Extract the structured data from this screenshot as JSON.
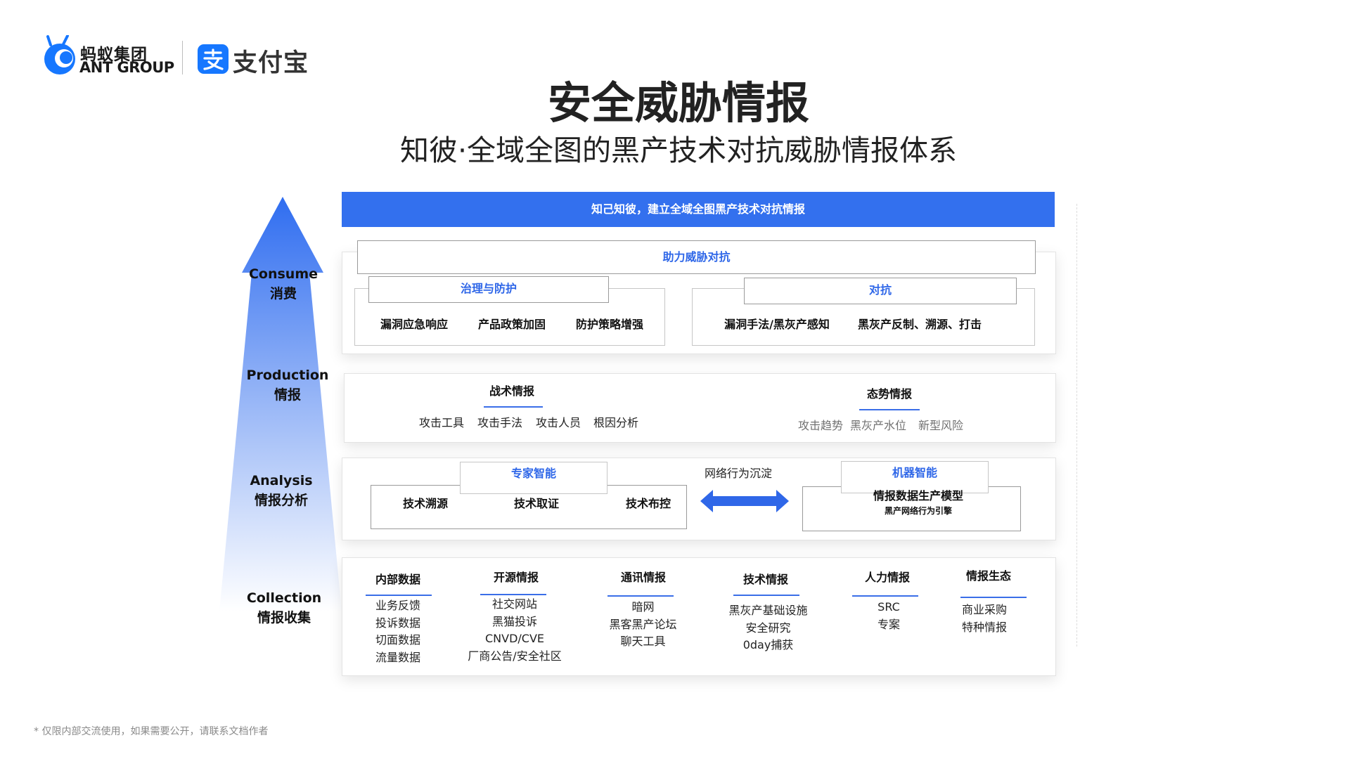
{
  "header": {
    "ant_group_cn": "蚂蚁集团",
    "ant_group_en": "ANT GROUP",
    "alipay": "支付宝",
    "title": "安全威胁情报",
    "subtitle": "知彼·全域全图的黑产技术对抗威胁情报体系"
  },
  "colors": {
    "primary_blue": "#3370ee",
    "accent_blue": "#2f67e8"
  },
  "levels": [
    {
      "en": "Consume",
      "cn": "消费"
    },
    {
      "en": "Production",
      "cn": "情报"
    },
    {
      "en": "Analysis",
      "cn": "情报分析"
    },
    {
      "en": "Collection",
      "cn": "情报收集"
    }
  ],
  "consume": {
    "banner": "知己知彼，建立全域全图黑产技术对抗情报",
    "assist_title": "助力威胁对抗",
    "governance": {
      "title": "治理与防护",
      "items": [
        "漏洞应急响应",
        "产品政策加固",
        "防护策略增强"
      ]
    },
    "counter": {
      "title": "对抗",
      "items": [
        "漏洞手法/黑灰产感知",
        "黑灰产反制、溯源、打击"
      ]
    }
  },
  "production": {
    "tactical": {
      "title": "战术情报",
      "items": [
        "攻击工具",
        "攻击手法",
        "攻击人员",
        "根因分析"
      ]
    },
    "situation": {
      "title": "态势情报",
      "items": [
        "攻击趋势",
        "黑灰产水位",
        "新型风险"
      ]
    }
  },
  "analysis": {
    "expert": {
      "title": "专家智能",
      "items": [
        "技术溯源",
        "技术取证",
        "技术布控"
      ]
    },
    "flow_label": "网络行为沉淀",
    "machine": {
      "title": "机器智能",
      "line1": "情报数据生产模型",
      "line2": "黑产网络行为引擎"
    }
  },
  "collection": {
    "columns": [
      {
        "title": "内部数据",
        "items": [
          "业务反馈",
          "投诉数据",
          "切面数据",
          "流量数据"
        ]
      },
      {
        "title": "开源情报",
        "items": [
          "社交网站",
          "黑猫投诉",
          "CNVD/CVE",
          "厂商公告/安全社区"
        ]
      },
      {
        "title": "通讯情报",
        "items": [
          "暗网",
          "黑客黑产论坛",
          "聊天工具"
        ]
      },
      {
        "title": "技术情报",
        "items": [
          "黑灰产基础设施",
          "安全研究",
          "0day捕获"
        ]
      },
      {
        "title": "人力情报",
        "items": [
          "SRC",
          "专案"
        ]
      },
      {
        "title": "情报生态",
        "items": [
          "商业采购",
          "特种情报"
        ]
      }
    ]
  },
  "footnote": "* 仅限内部交流使用，如果需要公开，请联系文档作者"
}
